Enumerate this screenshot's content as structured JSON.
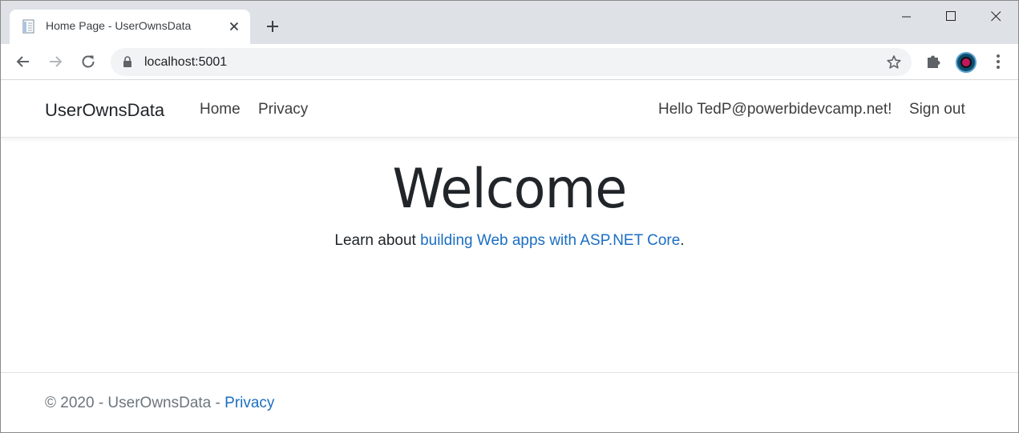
{
  "browser": {
    "tab_title": "Home Page - UserOwnsData",
    "address": "localhost:5001",
    "icons": {
      "favicon": "page-favicon-icon",
      "close": "close-icon",
      "new_tab": "plus-icon",
      "back": "back-arrow-icon",
      "forward": "forward-arrow-icon",
      "reload": "reload-icon",
      "lock": "lock-icon",
      "bookmark": "star-icon",
      "extensions": "puzzle-icon",
      "menu": "kebab-menu-icon"
    }
  },
  "navbar": {
    "brand": "UserOwnsData",
    "links": [
      {
        "label": "Home"
      },
      {
        "label": "Privacy"
      }
    ],
    "greeting": "Hello TedP@powerbidevcamp.net!",
    "signout": "Sign out"
  },
  "main": {
    "heading": "Welcome",
    "learn_prefix": "Learn about ",
    "learn_link": "building Web apps with ASP.NET Core",
    "learn_suffix": "."
  },
  "footer": {
    "text": "© 2020 - UserOwnsData - ",
    "link": "Privacy"
  },
  "colors": {
    "link": "#1b6ec2",
    "tabstrip": "#dee1e6",
    "omnibox": "#f1f3f4"
  }
}
